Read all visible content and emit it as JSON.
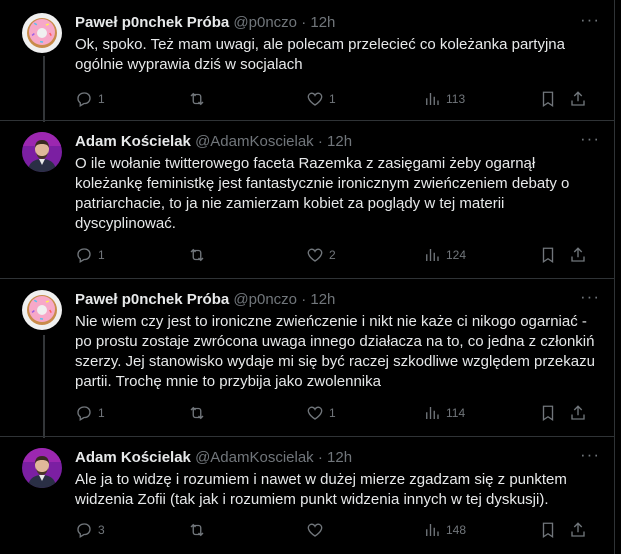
{
  "tweets": [
    {
      "name": "Paweł p0nchek Próba",
      "handle": "@p0nczo",
      "time": "12h",
      "text": "Ok, spoko. Też mam uwagi, ale polecam przelecieć co koleżanka partyjna ogólnie wyprawia dziś w socjalach",
      "replies": "1",
      "retweets": "",
      "likes": "1",
      "views": "113",
      "avatar": "donut"
    },
    {
      "name": "Adam Kościelak",
      "handle": "@AdamKoscielak",
      "time": "12h",
      "text": "O ile wołanie twitterowego faceta Razemka z zasięgami żeby ogarnął koleżankę feministkę jest fantastycznie ironicznym zwieńczeniem debaty o patriarchacie, to ja nie zamierzam kobiet za poglądy w tej materii dyscyplinować.",
      "replies": "1",
      "retweets": "",
      "likes": "2",
      "views": "124",
      "avatar": "person"
    },
    {
      "name": "Paweł p0nchek Próba",
      "handle": "@p0nczo",
      "time": "12h",
      "text": "Nie wiem czy jest to ironiczne zwieńczenie i nikt nie każe ci nikogo ogarniać - po prostu zostaje zwrócona uwaga innego działacza na to, co jedna z członkiń szerzy. Jej stanowisko wydaje mi się być raczej szkodliwe względem przekazu partii. Trochę mnie to przybija jako zwolennika",
      "replies": "1",
      "retweets": "",
      "likes": "1",
      "views": "114",
      "avatar": "donut"
    },
    {
      "name": "Adam Kościelak",
      "handle": "@AdamKoscielak",
      "time": "12h",
      "text": "Ale ja to widzę i rozumiem i nawet w dużej mierze zgadzam się z punktem widzenia Zofii (tak jak i rozumiem punkt widzenia innych w tej dyskusji).",
      "replies": "3",
      "retweets": "",
      "likes": "",
      "views": "148",
      "avatar": "person"
    }
  ],
  "icons": {
    "reply": "reply-icon",
    "retweet": "retweet-icon",
    "like": "heart-icon",
    "views": "views-icon",
    "bookmark": "bookmark-icon",
    "share": "share-icon",
    "more": "more-icon"
  },
  "colors": {
    "background": "#000000",
    "text": "#e7e9ea",
    "muted": "#71767b",
    "border": "#2f3336",
    "donut_pink": "#f7a8c8"
  }
}
